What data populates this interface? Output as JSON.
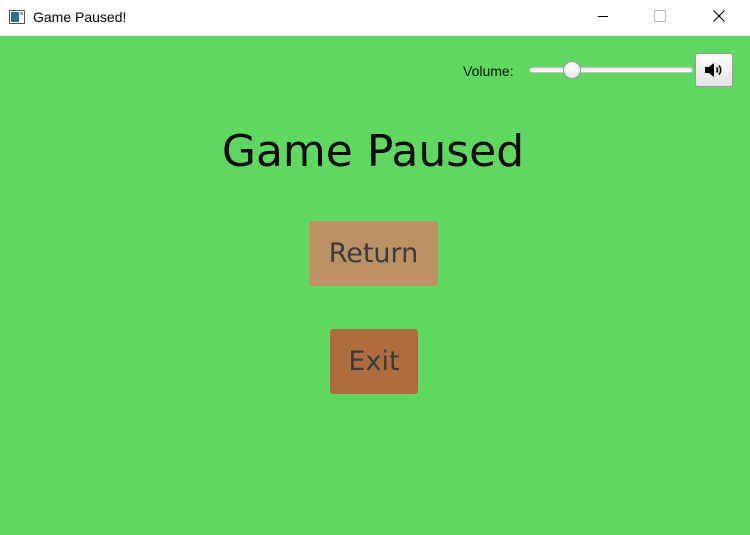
{
  "window": {
    "title": "Game Paused!",
    "icon": "app-window-icon",
    "controls": [
      "minimize-icon",
      "maximize-icon",
      "close-icon"
    ]
  },
  "colors": {
    "background": "#5fd760",
    "return_button": "#bb9164",
    "exit_button": "#ad6d3f"
  },
  "volume": {
    "label": "Volume:",
    "level": 0.26,
    "mute_icon": "speaker-icon"
  },
  "main": {
    "heading": "Game Paused",
    "return_label": "Return",
    "exit_label": "Exit"
  }
}
